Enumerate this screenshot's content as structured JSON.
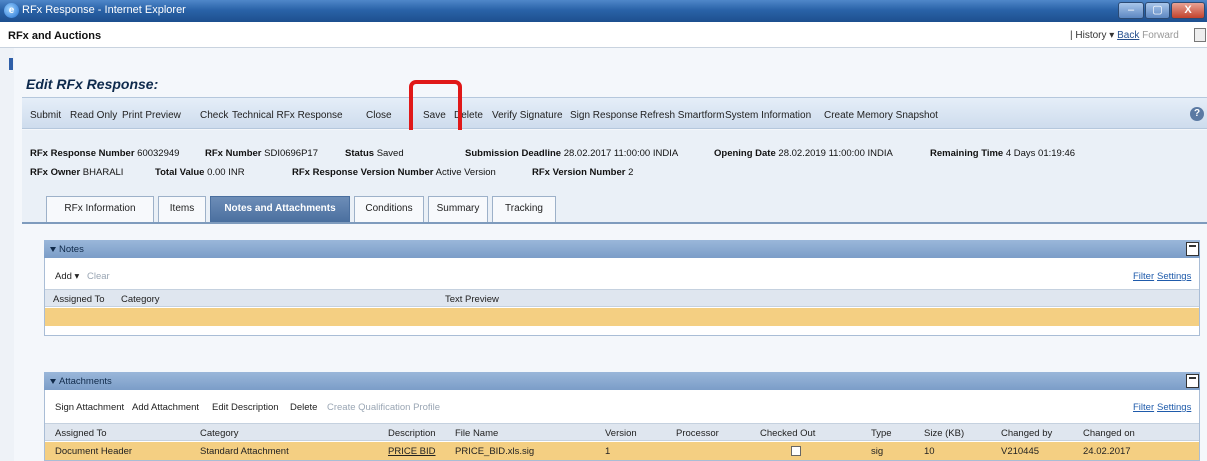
{
  "window": {
    "title": "RFx Response - Internet Explorer",
    "min": "–",
    "max": "▢",
    "close": "X"
  },
  "portal": {
    "app": "RFx and Auctions",
    "sep": "|",
    "history": "History",
    "back": "Back",
    "forward": "Forward"
  },
  "page": {
    "title": "Edit RFx Response:"
  },
  "toolbar": {
    "submit": "Submit",
    "read_only": "Read Only",
    "print_preview": "Print Preview",
    "check": "Check",
    "technical": "Technical RFx Response",
    "close": "Close",
    "save": "Save",
    "delete": "Delete",
    "verify": "Verify Signature",
    "sign": "Sign Response",
    "refresh": "Refresh Smartform",
    "sysinfo": "System Information",
    "snapshot": "Create Memory Snapshot",
    "help": "?"
  },
  "header": {
    "resp_num_label": "RFx Response Number",
    "resp_num": "60032949",
    "rfx_num_label": "RFx Number",
    "rfx_num": "SDI0696P17",
    "status_label": "Status",
    "status": "Saved",
    "deadline_label": "Submission Deadline",
    "deadline": "28.02.2017 11:00:00 INDIA",
    "opening_label": "Opening Date",
    "opening": "28.02.2019 11:00:00 INDIA",
    "remaining_label": "Remaining Time",
    "remaining": "4 Days 01:19:46",
    "owner_label": "RFx Owner",
    "owner": "BHARALI",
    "total_label": "Total Value",
    "total": "0.00 INR",
    "version_label": "RFx Response Version Number",
    "version": "Active Version",
    "rfx_version_label": "RFx Version Number",
    "rfx_version": "2"
  },
  "tabs": [
    "RFx Information",
    "Items",
    "Notes and Attachments",
    "Conditions",
    "Summary",
    "Tracking"
  ],
  "notes": {
    "title": "Notes",
    "add": "Add",
    "clear": "Clear",
    "filter": "Filter",
    "settings": "Settings",
    "columns": [
      "Assigned To",
      "Category",
      "Text Preview"
    ]
  },
  "attachments": {
    "title": "Attachments",
    "actions": [
      "Sign Attachment",
      "Add Attachment",
      "Edit Description",
      "Delete"
    ],
    "disabled_action": "Create Qualification Profile",
    "filter": "Filter",
    "settings": "Settings",
    "columns": [
      "Assigned To",
      "Category",
      "Description",
      "File Name",
      "Version",
      "Processor",
      "Checked Out",
      "Type",
      "Size (KB)",
      "Changed by",
      "Changed on"
    ],
    "rows": [
      {
        "assigned_to": "Document Header",
        "category": "Standard Attachment",
        "description": "PRICE BID",
        "file_name": "PRICE_BID.xls.sig",
        "version": "1",
        "processor": "",
        "checked_out": false,
        "type": "sig",
        "size": "10",
        "changed_by": "V210445",
        "changed_on": "24.02.2017"
      }
    ]
  },
  "colors": {
    "highlight": "#e01818",
    "selected_row": "#f4cf82",
    "tray_header": "#8fafd6"
  }
}
